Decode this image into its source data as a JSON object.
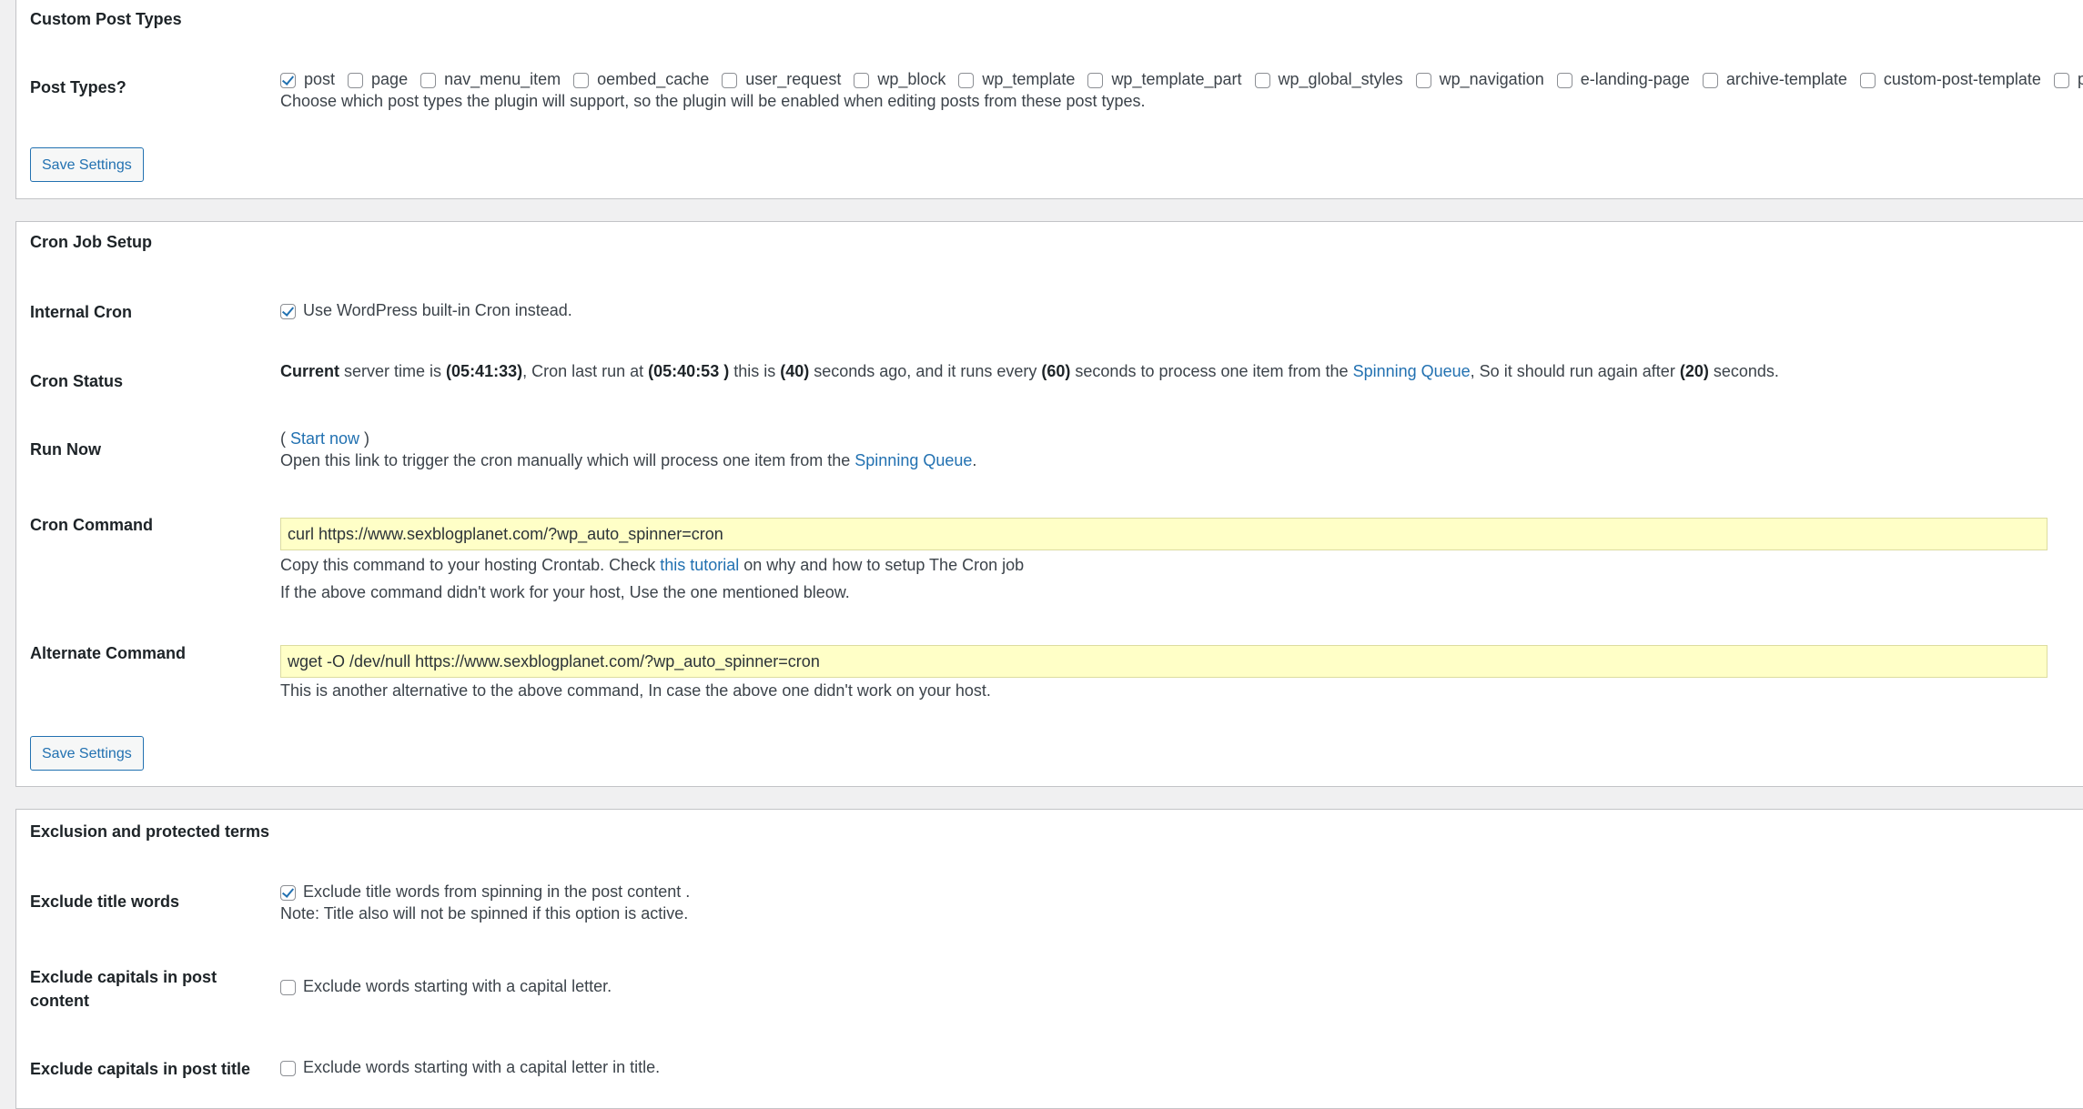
{
  "custom_post_types": {
    "title": "Custom Post Types",
    "post_types_label": "Post Types?",
    "post_types": [
      {
        "label": "post",
        "checked": true
      },
      {
        "label": "page",
        "checked": false
      },
      {
        "label": "nav_menu_item",
        "checked": false
      },
      {
        "label": "oembed_cache",
        "checked": false
      },
      {
        "label": "user_request",
        "checked": false
      },
      {
        "label": "wp_block",
        "checked": false
      },
      {
        "label": "wp_template",
        "checked": false
      },
      {
        "label": "wp_template_part",
        "checked": false
      },
      {
        "label": "wp_global_styles",
        "checked": false
      },
      {
        "label": "wp_navigation",
        "checked": false
      },
      {
        "label": "e-landing-page",
        "checked": false
      },
      {
        "label": "archive-template",
        "checked": false
      },
      {
        "label": "custom-post-template",
        "checked": false
      },
      {
        "label": "penci-block",
        "checked": false
      }
    ],
    "description": "Choose which post types the plugin will support, so the plugin will be enabled when editing posts from these post types.",
    "save_label": "Save Settings"
  },
  "cron": {
    "title": "Cron Job Setup",
    "internal_label": "Internal Cron",
    "internal_text": "Use WordPress built-in Cron instead.",
    "internal_checked": true,
    "status_label": "Cron Status",
    "status": {
      "current": "Current",
      "t1": " server time is ",
      "server_time": "(05:41:33)",
      "t2": ", Cron last run at ",
      "last_run": "(05:40:53 )",
      "t3": " this is ",
      "ago": "(40)",
      "t4": " seconds ago, and it runs every ",
      "every": "(60)",
      "t5": " seconds to process one item from the ",
      "queue_link": "Spinning Queue",
      "t6": ", So it should run again after ",
      "again": "(20)",
      "t7": " seconds."
    },
    "run_now_label": "Run Now",
    "run_now": {
      "open_paren": "( ",
      "link": "Start now",
      "close_paren": " )",
      "desc_prefix": "Open this link to trigger the cron manually which will process one item from the ",
      "queue_link": "Spinning Queue",
      "desc_suffix": "."
    },
    "command_label": "Cron Command",
    "command_value": "curl https://www.sexblogplanet.com/?wp_auto_spinner=cron",
    "command_help": {
      "prefix": "Copy this command to your hosting Crontab. Check ",
      "link": "this tutorial",
      "suffix": " on why and how to setup The Cron job",
      "line2": "If the above command didn't work for your host, Use the one mentioned bleow."
    },
    "alt_label": "Alternate Command",
    "alt_value": "wget -O /dev/null https://www.sexblogplanet.com/?wp_auto_spinner=cron",
    "alt_help": "This is another alternative to the above command, In case the above one didn't work on your host.",
    "save_label": "Save Settings"
  },
  "exclusion": {
    "title": "Exclusion and protected terms",
    "title_words_label": "Exclude title words",
    "title_words_text": "Exclude title words from spinning in the post content .",
    "title_words_note": "Note: Title also will not be spinned if this option is active.",
    "title_words_checked": true,
    "caps_content_label": "Exclude capitals in post content",
    "caps_content_text": "Exclude words starting with a capital letter.",
    "caps_content_checked": false,
    "caps_title_label": "Exclude capitals in post title",
    "caps_title_text": "Exclude words starting with a capital letter in title.",
    "caps_title_checked": false
  }
}
